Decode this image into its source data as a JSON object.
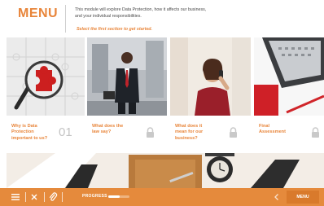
{
  "header": {
    "title": "MENU",
    "intro_line1": "This module will explore Data Protection, how it affects our business,",
    "intro_line2": "and your individual responsibilities.",
    "cta": "Select the first section to get started."
  },
  "sections": [
    {
      "label_lines": [
        "Why is Data",
        "Protection",
        "important to us?"
      ],
      "number": "01",
      "status": "available",
      "image": "puzzle-magnifier-photo"
    },
    {
      "label_lines": [
        "What does the",
        "law say?"
      ],
      "number": "",
      "status": "locked",
      "image": "businessman-photo"
    },
    {
      "label_lines": [
        "What does it",
        "mean for our",
        "business?"
      ],
      "number": "",
      "status": "locked",
      "image": "woman-on-phone-photo"
    },
    {
      "label_lines": [
        "Final",
        "Assessment"
      ],
      "number": "",
      "status": "locked",
      "image": "laptop-desk-photo"
    }
  ],
  "toolbar": {
    "progress_label": "PROGRESS",
    "progress_value": 0.55,
    "menu_label": "MENU",
    "icons": [
      "hamburger-icon",
      "close-icon",
      "paperclip-icon",
      "chevron-left-icon"
    ]
  },
  "colors": {
    "accent": "#e8853a",
    "toolbar": "#e58a3c",
    "lock": "#c9c9c9"
  }
}
